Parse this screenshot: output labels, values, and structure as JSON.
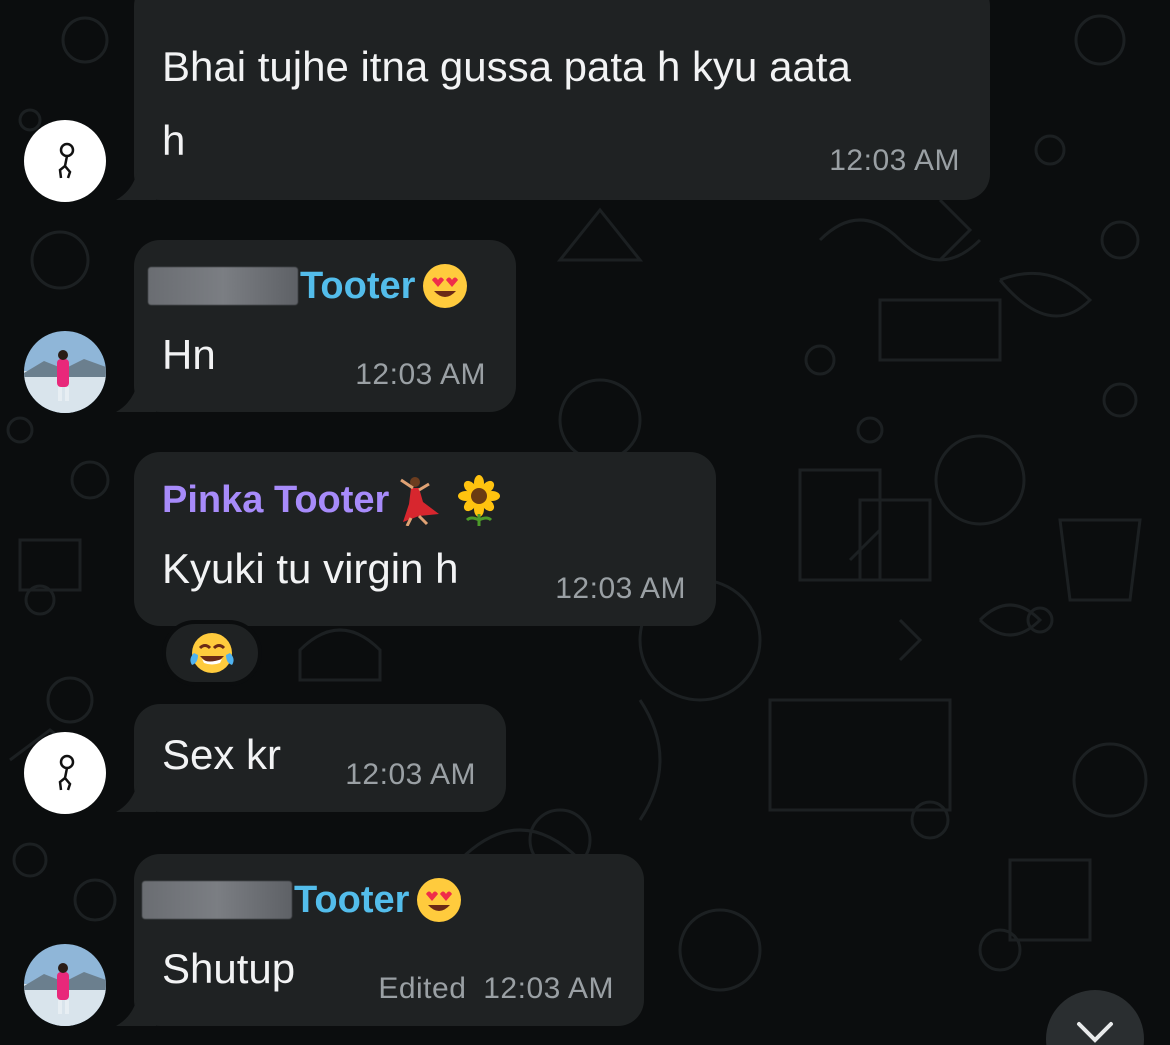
{
  "colors": {
    "background": "#0b0d0e",
    "bubble": "#1f2223",
    "sender_blue": "#53bdeb",
    "sender_purple": "#a78bfa",
    "text": "#f2f3f4",
    "timestamp": "#9aa0a4"
  },
  "messages": [
    {
      "text_line1": "Bhai tujhe itna gussa pata h kyu aata",
      "text_line2": "h",
      "time": "12:03 AM"
    },
    {
      "sender": "Tooter",
      "sender_emoji": "heart-eyes-emoji",
      "text": "Hn",
      "time": "12:03 AM"
    },
    {
      "sender": "Pinka Tooter",
      "sender_emoji": "dancer-sunflower-emoji",
      "text": "Kyuki tu virgin h",
      "time": "12:03 AM",
      "reaction": "tears-of-joy-emoji"
    },
    {
      "text": "Sex kr",
      "time": "12:03 AM"
    },
    {
      "sender": "Tooter",
      "sender_emoji": "heart-eyes-emoji",
      "text": "Shutup",
      "edited_label": "Edited",
      "time": "12:03 AM"
    }
  ],
  "scroll_button_icon": "chevron-down-icon"
}
